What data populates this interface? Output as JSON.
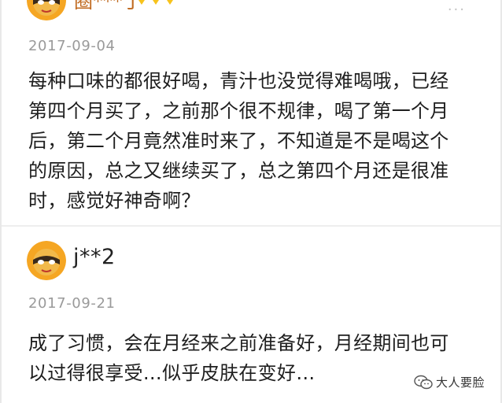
{
  "reviews": [
    {
      "username": "圈***丁",
      "date": "2017-09-04",
      "content": "每种口味的都很好喝，青汁也没觉得难喝哦，已经\n第四个月买了，之前那个很不规律，喝了第一个月\n后，第二个月竟然准时来了，不知道是不是喝这个\n的原因，总之又继续买了，总之第四个月还是很准\n时，感觉好神奇啊？",
      "more": "···"
    },
    {
      "username": "j**2",
      "date": "2017-09-21",
      "content": "成了习惯，会在月经来之前准备好，月经期间也可\n以过得很享受…似乎皮肤在变好…"
    }
  ],
  "watermark": {
    "text": "大人要脸"
  },
  "colors": {
    "avatar_orange": "#f5a623",
    "avatar_dark": "#3a2a1a",
    "badge_gold": "#f7c31c",
    "date_gray": "#9a9a9a"
  }
}
